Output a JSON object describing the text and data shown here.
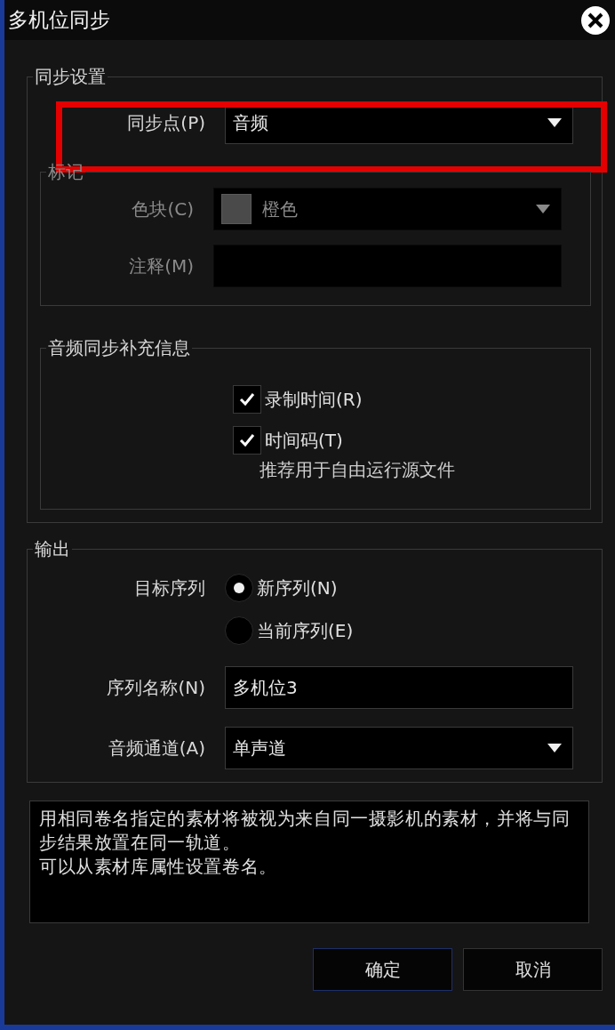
{
  "window": {
    "title": "多机位同步"
  },
  "sync_settings": {
    "title": "同步设置",
    "sync_point": {
      "label": "同步点(P)",
      "value": "音频"
    },
    "marker": {
      "title": "标记",
      "disabled": true,
      "color_label": "色块(C)",
      "color_value": "橙色",
      "comment_label": "注释(M)"
    },
    "audio_info": {
      "title": "音频同步补充信息",
      "options": [
        {
          "label": "录制时间(R)",
          "checked": true
        },
        {
          "label": "时间码(T)",
          "checked": true,
          "note": "推荐用于自由运行源文件"
        }
      ]
    }
  },
  "output": {
    "title": "输出",
    "target_label": "目标序列",
    "targets": [
      {
        "label": "新序列(N)",
        "selected": true
      },
      {
        "label": "当前序列(E)",
        "selected": false
      }
    ],
    "name_label": "序列名称(N)",
    "name_value": "多机位3",
    "channel_label": "音频通道(A)",
    "channel_value": "单声道"
  },
  "info_text": [
    "用相同卷名指定的素材将被视为来自同一摄影机的素材，并将与同步结果放置在同一轨道。",
    "可以从素材库属性设置卷名。"
  ],
  "buttons": [
    "确定",
    "取消"
  ],
  "annotation": {
    "kind": "highlight"
  }
}
